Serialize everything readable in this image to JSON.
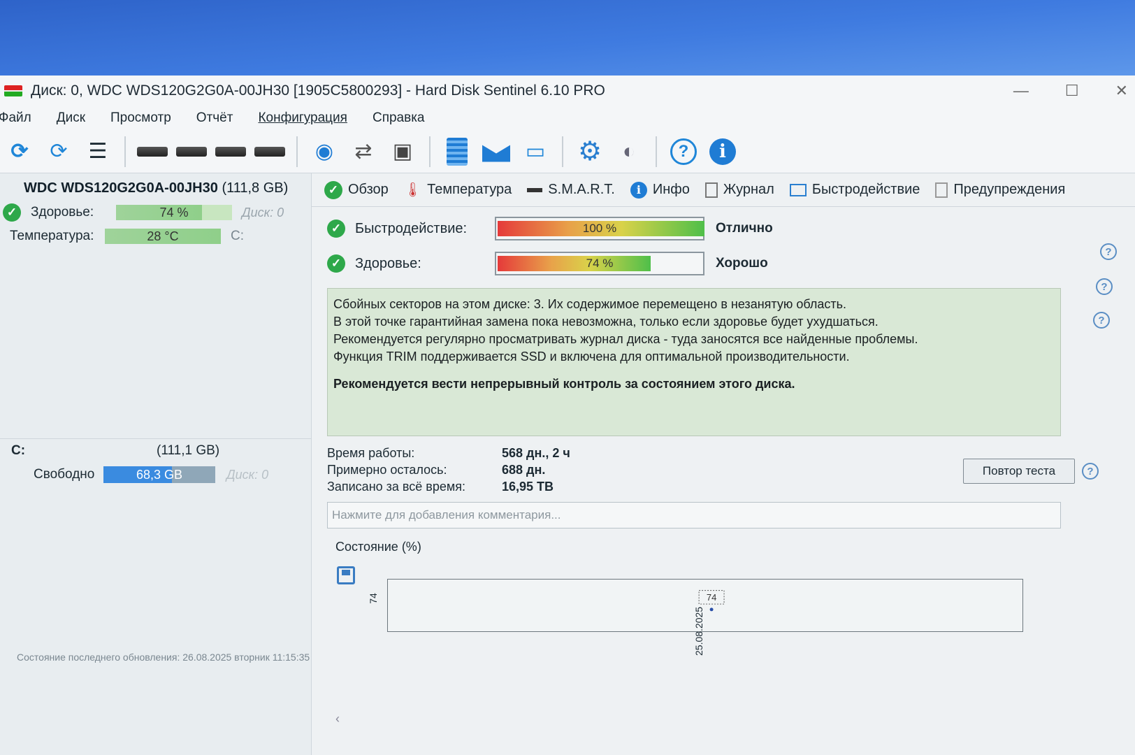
{
  "window": {
    "title": "Диск: 0, WDC WDS120G2G0A-00JH30 [1905C5800293]  -  Hard Disk Sentinel 6.10 PRO",
    "controls": {
      "minimize": "—",
      "maximize": "☐",
      "close": "✕"
    }
  },
  "menu": [
    "Файл",
    "Диск",
    "Просмотр",
    "Отчёт",
    "Конфигурация",
    "Справка"
  ],
  "toolbar_icons": [
    "refresh-icon",
    "refresh-warning-icon",
    "disk-list-icon",
    "disk-icon",
    "disk-timer-icon",
    "disk-check-icon",
    "disk-search-icon",
    "globe-disk-icon",
    "network-icon",
    "computer-icon",
    "report-icon",
    "mail-icon",
    "monitor-icon",
    "gear-icon",
    "sound-icon",
    "help-icon",
    "info-icon"
  ],
  "left_panel": {
    "disk_name": "WDC WDS120G2G0A-00JH30",
    "disk_capacity": "(111,8 GB)",
    "health_label": "Здоровье:",
    "health_value": "74 %",
    "health_fraction": 0.74,
    "health_disk": "Диск: 0",
    "temp_label": "Температура:",
    "temp_value": "28 °C",
    "temp_drive": "C:",
    "volume_letter": "C:",
    "volume_capacity": "(111,1 GB)",
    "free_label": "Свободно",
    "free_value": "68,3 GB",
    "free_fraction": 0.61,
    "free_disk": "Диск: 0"
  },
  "tabs": [
    {
      "label": "Обзор",
      "icon": "check-icon"
    },
    {
      "label": "Температура",
      "icon": "thermometer-icon"
    },
    {
      "label": "S.M.A.R.T.",
      "icon": "smart-icon"
    },
    {
      "label": "Инфо",
      "icon": "info-icon"
    },
    {
      "label": "Журнал",
      "icon": "document-icon"
    },
    {
      "label": "Быстродействие",
      "icon": "performance-chart-icon"
    },
    {
      "label": "Предупреждения",
      "icon": "warnings-icon"
    }
  ],
  "overview": {
    "performance_label": "Быстродействие:",
    "performance_value": "100 %",
    "performance_fraction": 1.0,
    "performance_verdict": "Отлично",
    "health_label": "Здоровье:",
    "health_value": "74 %",
    "health_fraction": 0.74,
    "health_verdict": "Хорошо",
    "message_lines": [
      "Сбойных секторов на этом диске: 3. Их содержимое перемещено в незанятую область.",
      "В этой точке гарантийная замена пока невозможна, только если здоровье будет ухудшаться.",
      "Рекомендуется регулярно просматривать журнал диска - туда заносятся все найденные проблемы.",
      "Функция TRIM поддерживается SSD и включена для оптимальной производительности."
    ],
    "message_bold": "Рекомендуется вести непрерывный контроль за состоянием этого диска.",
    "uptime_label": "Время работы:",
    "uptime_value": "568 дн., 2 ч",
    "remaining_label": "Примерно осталось:",
    "remaining_value": "688 дн.",
    "written_label": "Записано за всё время:",
    "written_value": "16,95 TB",
    "retest_button": "Повтор теста",
    "comment_placeholder": "Нажмите для добавления комментария...",
    "state_label": "Состояние (%)"
  },
  "chart_data": {
    "type": "line",
    "x": [
      "25.08.2025"
    ],
    "series": [
      {
        "values": [
          74
        ]
      }
    ],
    "data_labels": [
      "74"
    ],
    "y_ticks": [
      "74"
    ],
    "grid": false
  },
  "status_bar": "Состояние последнего обновления: 26.08.2025 вторник 11:15:35"
}
